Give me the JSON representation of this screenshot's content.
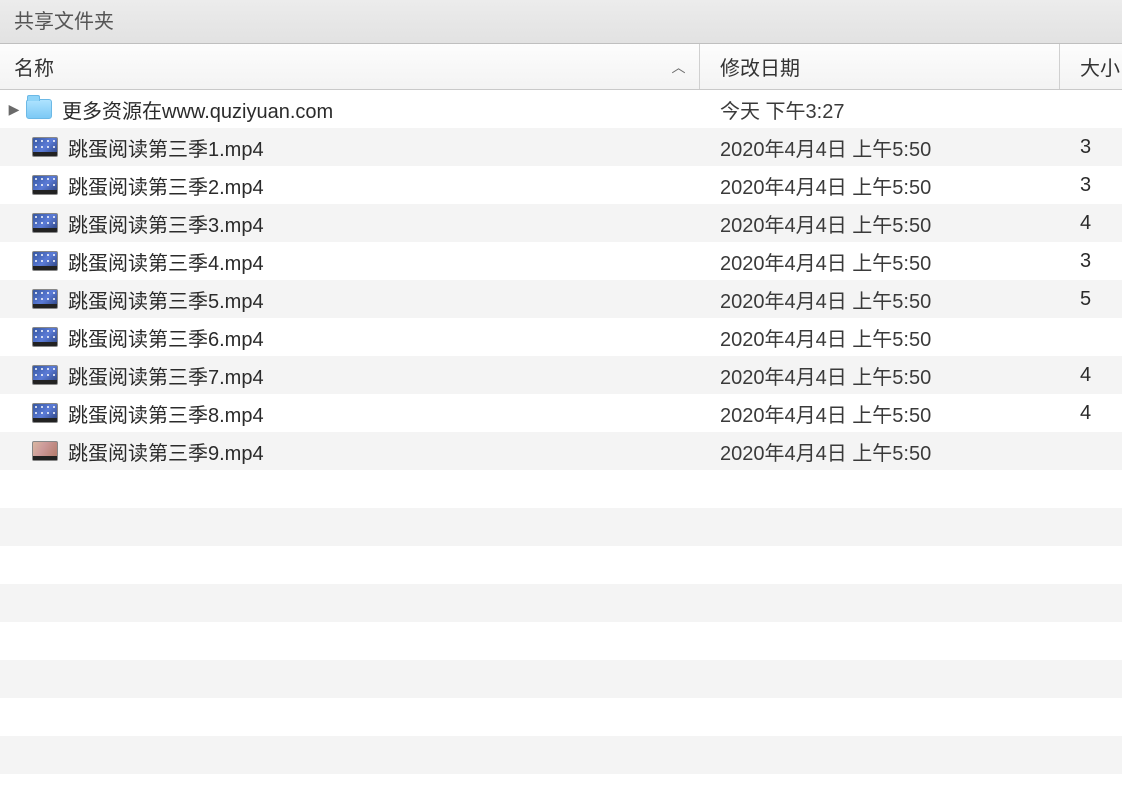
{
  "title": "共享文件夹",
  "columns": {
    "name": "名称",
    "date": "修改日期",
    "size": "大小"
  },
  "rows": [
    {
      "type": "folder",
      "name": "更多资源在www.quziyuan.com",
      "date": "今天 下午3:27",
      "size": "",
      "expandable": true
    },
    {
      "type": "video",
      "name": "跳蛋阅读第三季1.mp4",
      "date": "2020年4月4日 上午5:50",
      "size": "3"
    },
    {
      "type": "video",
      "name": "跳蛋阅读第三季2.mp4",
      "date": "2020年4月4日 上午5:50",
      "size": "3"
    },
    {
      "type": "video",
      "name": "跳蛋阅读第三季3.mp4",
      "date": "2020年4月4日 上午5:50",
      "size": "4"
    },
    {
      "type": "video",
      "name": "跳蛋阅读第三季4.mp4",
      "date": "2020年4月4日 上午5:50",
      "size": "3"
    },
    {
      "type": "video",
      "name": "跳蛋阅读第三季5.mp4",
      "date": "2020年4月4日 上午5:50",
      "size": "5"
    },
    {
      "type": "video",
      "name": "跳蛋阅读第三季6.mp4",
      "date": "2020年4月4日 上午5:50",
      "size": ""
    },
    {
      "type": "video",
      "name": "跳蛋阅读第三季7.mp4",
      "date": "2020年4月4日 上午5:50",
      "size": "4"
    },
    {
      "type": "video",
      "name": "跳蛋阅读第三季8.mp4",
      "date": "2020年4月4日 上午5:50",
      "size": "4"
    },
    {
      "type": "video2",
      "name": "跳蛋阅读第三季9.mp4",
      "date": "2020年4月4日 上午5:50",
      "size": ""
    }
  ],
  "visible_row_slots": 18
}
